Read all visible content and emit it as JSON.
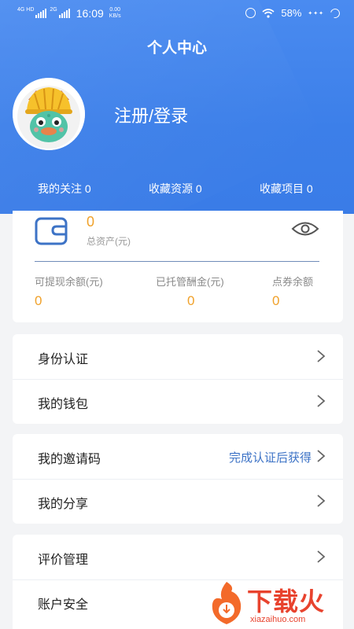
{
  "status_bar": {
    "network_1": "4G HD",
    "network_2": "2G",
    "time": "16:09",
    "speed_value": "0.00",
    "speed_unit": "KB/s",
    "battery": "58%",
    "icons": [
      "alarm-icon",
      "wifi-icon",
      "sparkle-icon",
      "moon-icon"
    ]
  },
  "header": {
    "title": "个人中心",
    "login_text": "注册/登录",
    "stats": [
      {
        "label": "我的关注 0"
      },
      {
        "label": "收藏资源 0"
      },
      {
        "label": "收藏项目 0"
      }
    ]
  },
  "assets": {
    "total_value": "0",
    "total_label": "总资产(元)",
    "balances": [
      {
        "label": "可提现余额(元)",
        "value": "0"
      },
      {
        "label": "已托管酬金(元)",
        "value": "0"
      },
      {
        "label": "点券余额",
        "value": "0"
      }
    ]
  },
  "menu": {
    "group1": [
      {
        "label": "身份认证"
      },
      {
        "label": "我的钱包"
      }
    ],
    "group2": [
      {
        "label": "我的邀请码",
        "hint": "完成认证后获得"
      },
      {
        "label": "我的分享"
      }
    ],
    "group3": [
      {
        "label": "评价管理"
      },
      {
        "label": "账户安全"
      }
    ]
  },
  "watermark": {
    "brand": "下载火",
    "url": "xiazaihuo.com"
  },
  "colors": {
    "header_blue": "#3c7fe9",
    "amount_orange": "#f0a12a",
    "hint_blue": "#3d73c6",
    "watermark_red": "#e8432e"
  }
}
